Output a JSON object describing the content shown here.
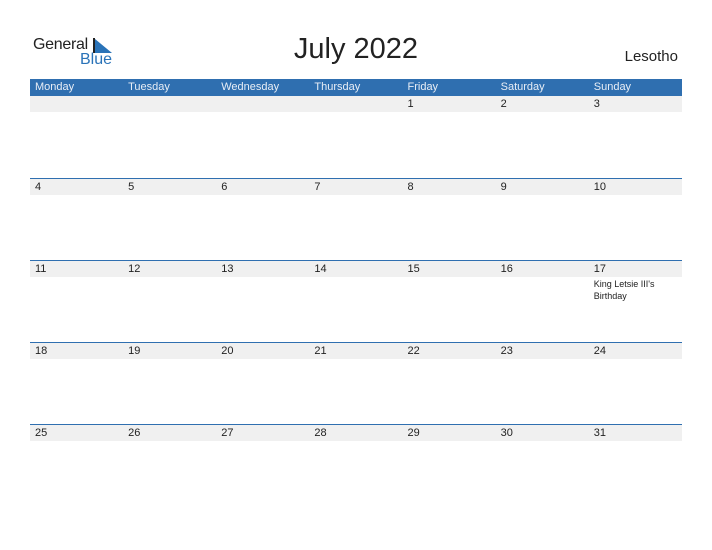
{
  "logo": {
    "word1": "General",
    "word2": "Blue"
  },
  "title": "July 2022",
  "country": "Lesotho",
  "colors": {
    "accent": "#2f6fb0",
    "date_row_bg": "#f0f0f0"
  },
  "weekdays": [
    "Monday",
    "Tuesday",
    "Wednesday",
    "Thursday",
    "Friday",
    "Saturday",
    "Sunday"
  ],
  "weeks": [
    {
      "days": [
        "",
        "",
        "",
        "",
        "1",
        "2",
        "3"
      ],
      "events": [
        "",
        "",
        "",
        "",
        "",
        "",
        ""
      ]
    },
    {
      "days": [
        "4",
        "5",
        "6",
        "7",
        "8",
        "9",
        "10"
      ],
      "events": [
        "",
        "",
        "",
        "",
        "",
        "",
        ""
      ]
    },
    {
      "days": [
        "11",
        "12",
        "13",
        "14",
        "15",
        "16",
        "17"
      ],
      "events": [
        "",
        "",
        "",
        "",
        "",
        "",
        "King Letsie III's Birthday"
      ]
    },
    {
      "days": [
        "18",
        "19",
        "20",
        "21",
        "22",
        "23",
        "24"
      ],
      "events": [
        "",
        "",
        "",
        "",
        "",
        "",
        ""
      ]
    },
    {
      "days": [
        "25",
        "26",
        "27",
        "28",
        "29",
        "30",
        "31"
      ],
      "events": [
        "",
        "",
        "",
        "",
        "",
        "",
        ""
      ]
    }
  ]
}
